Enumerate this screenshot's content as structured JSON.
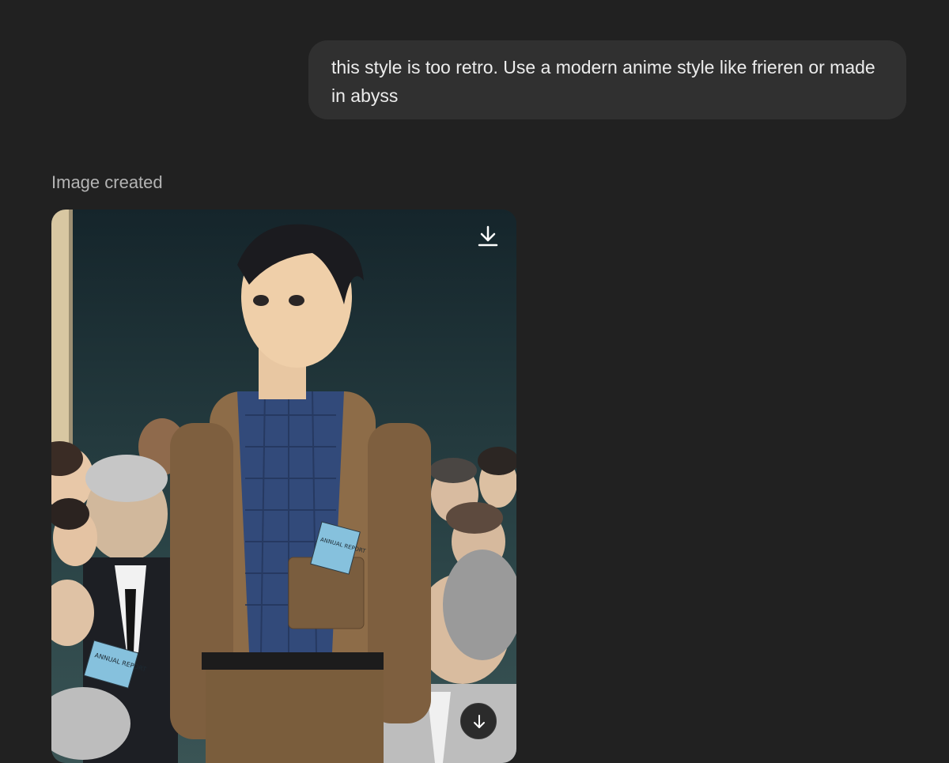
{
  "conversation": {
    "user_message": "this style is too retro. Use a modern anime style like frieren or made in abyss",
    "status_label": "Image created"
  },
  "generated_image": {
    "book_labels": [
      "ANNUAL REPORT",
      "ANNUAL REPORT"
    ]
  },
  "icons": {
    "download": "download-icon",
    "scroll_down": "arrow-down-icon"
  },
  "colors": {
    "background": "#212121",
    "bubble": "#303030",
    "text": "#ececec",
    "muted": "#b4b4b4"
  }
}
